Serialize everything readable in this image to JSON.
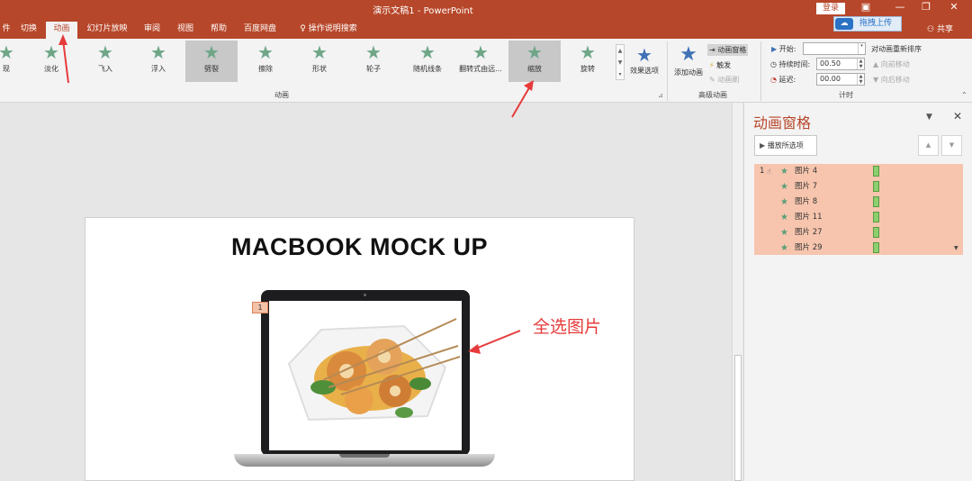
{
  "window": {
    "title": "演示文稿1 - PowerPoint",
    "login_label": "登录",
    "upload_label": "拖拽上传",
    "share_label": "共享",
    "controls": [
      "restore-window-icon",
      "minimize-icon",
      "maximize-icon",
      "close-icon"
    ]
  },
  "tabs": [
    {
      "label": "件"
    },
    {
      "label": "切换"
    },
    {
      "label": "动画",
      "active": true
    },
    {
      "label": "幻灯片放映"
    },
    {
      "label": "审阅"
    },
    {
      "label": "视图"
    },
    {
      "label": "帮助"
    },
    {
      "label": "百度网盘"
    },
    {
      "label": "操作说明搜索"
    }
  ],
  "ribbon": {
    "effects": [
      {
        "label": "现"
      },
      {
        "label": "淡化"
      },
      {
        "label": "飞入"
      },
      {
        "label": "浮入"
      },
      {
        "label": "劈裂",
        "selected": true
      },
      {
        "label": "擦除"
      },
      {
        "label": "形状"
      },
      {
        "label": "轮子"
      },
      {
        "label": "随机线条"
      },
      {
        "label": "翻转式由远..."
      },
      {
        "label": "缩放",
        "selected": true
      },
      {
        "label": "旋转"
      }
    ],
    "effect_options_label": "效果选项",
    "animation_group_label": "动画",
    "add_animation_label": "添加动画",
    "animation_pane_label": "动画窗格",
    "trigger_label": "触发",
    "animation_painter_label": "动画刷",
    "advanced_group_label": "高级动画",
    "start_label": "开始:",
    "duration_label": "持续时间:",
    "duration_value": "00.50",
    "delay_label": "延迟:",
    "delay_value": "00.00",
    "reorder_label": "对动画重新排序",
    "move_earlier_label": "向前移动",
    "move_later_label": "向后移动",
    "timing_group_label": "计时"
  },
  "slide": {
    "title": "MACBOOK MOCK UP",
    "animation_tag": "1"
  },
  "annotation": {
    "text": "全选图片",
    "color": "#e63b3b"
  },
  "pane": {
    "title": "动画窗格",
    "play_label": "播放所选项",
    "items": [
      {
        "number": "1",
        "name": "图片 4"
      },
      {
        "number": "",
        "name": "图片 7"
      },
      {
        "number": "",
        "name": "图片 8"
      },
      {
        "number": "",
        "name": "图片 11"
      },
      {
        "number": "",
        "name": "图片 27"
      },
      {
        "number": "",
        "name": "图片 29"
      }
    ]
  },
  "colors": {
    "accent": "#b7472a",
    "selection": "#f7c5ae",
    "timeline_bar": "#8ccf6e"
  }
}
